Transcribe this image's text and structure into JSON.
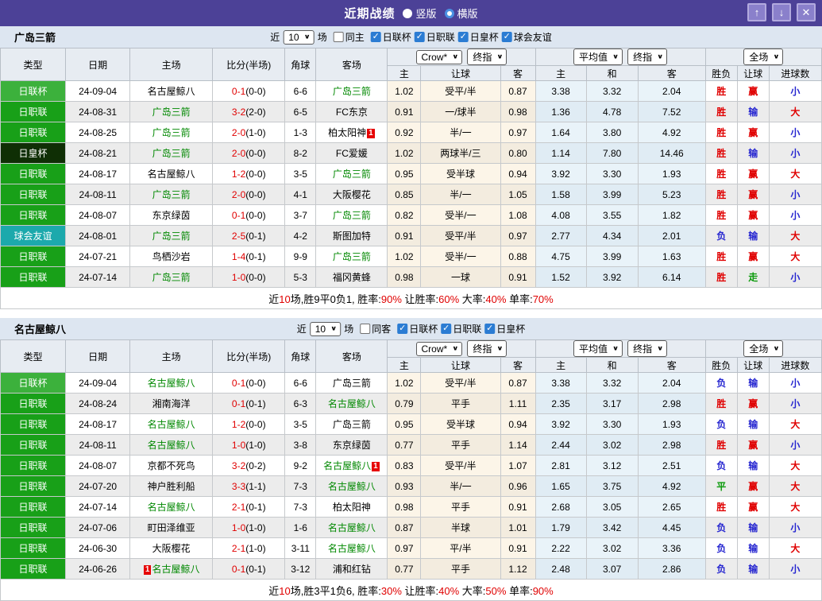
{
  "icons": {
    "check": "✓",
    "chevron": "∨",
    "up": "↑",
    "down": "↓",
    "close": "✕"
  },
  "colors": {
    "titlebar_bg": "#4c4197",
    "titlebar_button_bg": "#8a80cb",
    "section_bar_bg": "#dde6f1",
    "header_bg": "#e7ecf2",
    "league_cup": "#3cb13c",
    "league_j1": "#18a018",
    "league_emperor": "#0f2f05",
    "league_friendly": "#1ca9ac",
    "focus_team": "#008800",
    "score_red": "#e00000",
    "win_red": "#e00000",
    "lose_blue": "#2525d0",
    "draw_green": "#0a9a0a",
    "handicap_col_bg": "#fcf5e8",
    "avg_col_bg": "#e9f3f9",
    "red_card_badge": "#e60000",
    "checkbox_blue": "#2b7cd3"
  },
  "titlebar": {
    "title": "近期战绩",
    "radio_vertical": "竖版",
    "radio_horizontal": "横版"
  },
  "columns": {
    "type": "类型",
    "date": "日期",
    "home": "主场",
    "score": "比分(半场)",
    "corner": "角球",
    "away": "客场",
    "o_home": "主",
    "o_hcap": "让球",
    "o_away": "客",
    "a_home": "主",
    "a_draw": "和",
    "a_away": "客",
    "r_result": "胜负",
    "r_hcap": "让球",
    "r_goals": "进球数"
  },
  "tables": {
    "t1": {
      "team": "广岛三箭",
      "controls": {
        "near": "近",
        "count": "10",
        "games": "场",
        "same": "同主",
        "leagues": [
          "日联杯",
          "日职联",
          "日皇杯",
          "球会友谊"
        ]
      },
      "selects": {
        "odds_source": "Crow*",
        "odds_time": "终指",
        "avg": "平均值",
        "avg_time": "终指",
        "scope": "全场"
      },
      "rows": [
        {
          "lg": "日联杯",
          "lk": "cup",
          "date": "24-09-04",
          "hp": "",
          "h": "名古屋鲸八",
          "hb": "",
          "score": "0-1",
          "half": "(0-0)",
          "ck": "6-6",
          "ap": "",
          "a": "广岛三箭",
          "ab": "",
          "o1": "1.02",
          "oh": "受平/半",
          "o2": "0.87",
          "m1": "3.38",
          "m2": "3.32",
          "m3": "2.04",
          "r1": "胜",
          "r2": "赢",
          "r3": "小"
        },
        {
          "lg": "日职联",
          "lk": "j",
          "date": "24-08-31",
          "hp": "",
          "h": "广岛三箭",
          "hb": "",
          "score": "3-2",
          "half": "(2-0)",
          "ck": "6-5",
          "ap": "",
          "a": "FC东京",
          "ab": "",
          "o1": "0.91",
          "oh": "一/球半",
          "o2": "0.98",
          "m1": "1.36",
          "m2": "4.78",
          "m3": "7.52",
          "r1": "胜",
          "r2": "输",
          "r3": "大"
        },
        {
          "lg": "日职联",
          "lk": "j",
          "date": "24-08-25",
          "hp": "",
          "h": "广岛三箭",
          "hb": "",
          "score": "2-0",
          "half": "(1-0)",
          "ck": "1-3",
          "ap": "",
          "a": "柏太阳神",
          "ab": "1",
          "o1": "0.92",
          "oh": "半/一",
          "o2": "0.97",
          "m1": "1.64",
          "m2": "3.80",
          "m3": "4.92",
          "r1": "胜",
          "r2": "赢",
          "r3": "小"
        },
        {
          "lg": "日皇杯",
          "lk": "emp",
          "date": "24-08-21",
          "hp": "",
          "h": "广岛三箭",
          "hb": "",
          "score": "2-0",
          "half": "(0-0)",
          "ck": "8-2",
          "ap": "",
          "a": "FC爱媛",
          "ab": "",
          "o1": "1.02",
          "oh": "两球半/三",
          "o2": "0.80",
          "m1": "1.14",
          "m2": "7.80",
          "m3": "14.46",
          "r1": "胜",
          "r2": "输",
          "r3": "小"
        },
        {
          "lg": "日职联",
          "lk": "j",
          "date": "24-08-17",
          "hp": "",
          "h": "名古屋鲸八",
          "hb": "",
          "score": "1-2",
          "half": "(0-0)",
          "ck": "3-5",
          "ap": "",
          "a": "广岛三箭",
          "ab": "",
          "o1": "0.95",
          "oh": "受半球",
          "o2": "0.94",
          "m1": "3.92",
          "m2": "3.30",
          "m3": "1.93",
          "r1": "胜",
          "r2": "赢",
          "r3": "大"
        },
        {
          "lg": "日职联",
          "lk": "j",
          "date": "24-08-11",
          "hp": "",
          "h": "广岛三箭",
          "hb": "",
          "score": "2-0",
          "half": "(0-0)",
          "ck": "4-1",
          "ap": "",
          "a": "大阪樱花",
          "ab": "",
          "o1": "0.85",
          "oh": "半/一",
          "o2": "1.05",
          "m1": "1.58",
          "m2": "3.99",
          "m3": "5.23",
          "r1": "胜",
          "r2": "赢",
          "r3": "小"
        },
        {
          "lg": "日职联",
          "lk": "j",
          "date": "24-08-07",
          "hp": "",
          "h": "东京绿茵",
          "hb": "",
          "score": "0-1",
          "half": "(0-0)",
          "ck": "3-7",
          "ap": "",
          "a": "广岛三箭",
          "ab": "",
          "o1": "0.82",
          "oh": "受半/一",
          "o2": "1.08",
          "m1": "4.08",
          "m2": "3.55",
          "m3": "1.82",
          "r1": "胜",
          "r2": "赢",
          "r3": "小"
        },
        {
          "lg": "球会友谊",
          "lk": "fr",
          "date": "24-08-01",
          "hp": "",
          "h": "广岛三箭",
          "hb": "",
          "score": "2-5",
          "half": "(0-1)",
          "ck": "4-2",
          "ap": "",
          "a": "斯图加特",
          "ab": "",
          "o1": "0.91",
          "oh": "受平/半",
          "o2": "0.97",
          "m1": "2.77",
          "m2": "4.34",
          "m3": "2.01",
          "r1": "负",
          "r2": "输",
          "r3": "大"
        },
        {
          "lg": "日职联",
          "lk": "j",
          "date": "24-07-21",
          "hp": "",
          "h": "鸟栖沙岩",
          "hb": "",
          "score": "1-4",
          "half": "(0-1)",
          "ck": "9-9",
          "ap": "",
          "a": "广岛三箭",
          "ab": "",
          "o1": "1.02",
          "oh": "受半/一",
          "o2": "0.88",
          "m1": "4.75",
          "m2": "3.99",
          "m3": "1.63",
          "r1": "胜",
          "r2": "赢",
          "r3": "大"
        },
        {
          "lg": "日职联",
          "lk": "j",
          "date": "24-07-14",
          "hp": "",
          "h": "广岛三箭",
          "hb": "",
          "score": "1-0",
          "half": "(0-0)",
          "ck": "5-3",
          "ap": "",
          "a": "福冈黄蜂",
          "ab": "",
          "o1": "0.98",
          "oh": "一球",
          "o2": "0.91",
          "m1": "1.52",
          "m2": "3.92",
          "m3": "6.14",
          "r1": "胜",
          "r2": "走",
          "r3": "小"
        }
      ],
      "summary": {
        "p1": "近",
        "p2": "10",
        "p3": "场,胜9平0负1, 胜率:",
        "p4": "90%",
        "p5": " 让胜率:",
        "p6": "60%",
        "p7": " 大率:",
        "p8": "40%",
        "p9": " 单率:",
        "p10": "70%"
      }
    },
    "t2": {
      "team": "名古屋鲸八",
      "controls": {
        "near": "近",
        "count": "10",
        "games": "场",
        "same": "同客",
        "leagues": [
          "日联杯",
          "日职联",
          "日皇杯"
        ]
      },
      "selects": {
        "odds_source": "Crow*",
        "odds_time": "终指",
        "avg": "平均值",
        "avg_time": "终指",
        "scope": "全场"
      },
      "rows": [
        {
          "lg": "日联杯",
          "lk": "cup",
          "date": "24-09-04",
          "hp": "",
          "h": "名古屋鲸八",
          "hb": "",
          "score": "0-1",
          "half": "(0-0)",
          "ck": "6-6",
          "ap": "",
          "a": "广岛三箭",
          "ab": "",
          "o1": "1.02",
          "oh": "受平/半",
          "o2": "0.87",
          "m1": "3.38",
          "m2": "3.32",
          "m3": "2.04",
          "r1": "负",
          "r2": "输",
          "r3": "小"
        },
        {
          "lg": "日职联",
          "lk": "j",
          "date": "24-08-24",
          "hp": "",
          "h": "湘南海洋",
          "hb": "",
          "score": "0-1",
          "half": "(0-1)",
          "ck": "6-3",
          "ap": "",
          "a": "名古屋鲸八",
          "ab": "",
          "o1": "0.79",
          "oh": "平手",
          "o2": "1.11",
          "m1": "2.35",
          "m2": "3.17",
          "m3": "2.98",
          "r1": "胜",
          "r2": "赢",
          "r3": "小"
        },
        {
          "lg": "日职联",
          "lk": "j",
          "date": "24-08-17",
          "hp": "",
          "h": "名古屋鲸八",
          "hb": "",
          "score": "1-2",
          "half": "(0-0)",
          "ck": "3-5",
          "ap": "",
          "a": "广岛三箭",
          "ab": "",
          "o1": "0.95",
          "oh": "受半球",
          "o2": "0.94",
          "m1": "3.92",
          "m2": "3.30",
          "m3": "1.93",
          "r1": "负",
          "r2": "输",
          "r3": "大"
        },
        {
          "lg": "日职联",
          "lk": "j",
          "date": "24-08-11",
          "hp": "",
          "h": "名古屋鲸八",
          "hb": "",
          "score": "1-0",
          "half": "(1-0)",
          "ck": "3-8",
          "ap": "",
          "a": "东京绿茵",
          "ab": "",
          "o1": "0.77",
          "oh": "平手",
          "o2": "1.14",
          "m1": "2.44",
          "m2": "3.02",
          "m3": "2.98",
          "r1": "胜",
          "r2": "赢",
          "r3": "小"
        },
        {
          "lg": "日职联",
          "lk": "j",
          "date": "24-08-07",
          "hp": "",
          "h": "京都不死鸟",
          "hb": "",
          "score": "3-2",
          "half": "(0-2)",
          "ck": "9-2",
          "ap": "",
          "a": "名古屋鲸八",
          "ab": "1",
          "o1": "0.83",
          "oh": "受平/半",
          "o2": "1.07",
          "m1": "2.81",
          "m2": "3.12",
          "m3": "2.51",
          "r1": "负",
          "r2": "输",
          "r3": "大"
        },
        {
          "lg": "日职联",
          "lk": "j",
          "date": "24-07-20",
          "hp": "",
          "h": "神户胜利船",
          "hb": "",
          "score": "3-3",
          "half": "(1-1)",
          "ck": "7-3",
          "ap": "",
          "a": "名古屋鲸八",
          "ab": "",
          "o1": "0.93",
          "oh": "半/一",
          "o2": "0.96",
          "m1": "1.65",
          "m2": "3.75",
          "m3": "4.92",
          "r1": "平",
          "r2": "赢",
          "r3": "大"
        },
        {
          "lg": "日职联",
          "lk": "j",
          "date": "24-07-14",
          "hp": "",
          "h": "名古屋鲸八",
          "hb": "",
          "score": "2-1",
          "half": "(0-1)",
          "ck": "7-3",
          "ap": "",
          "a": "柏太阳神",
          "ab": "",
          "o1": "0.98",
          "oh": "平手",
          "o2": "0.91",
          "m1": "2.68",
          "m2": "3.05",
          "m3": "2.65",
          "r1": "胜",
          "r2": "赢",
          "r3": "大"
        },
        {
          "lg": "日职联",
          "lk": "j",
          "date": "24-07-06",
          "hp": "",
          "h": "町田泽维亚",
          "hb": "",
          "score": "1-0",
          "half": "(1-0)",
          "ck": "1-6",
          "ap": "",
          "a": "名古屋鲸八",
          "ab": "",
          "o1": "0.87",
          "oh": "半球",
          "o2": "1.01",
          "m1": "1.79",
          "m2": "3.42",
          "m3": "4.45",
          "r1": "负",
          "r2": "输",
          "r3": "小"
        },
        {
          "lg": "日职联",
          "lk": "j",
          "date": "24-06-30",
          "hp": "",
          "h": "大阪樱花",
          "hb": "",
          "score": "2-1",
          "half": "(1-0)",
          "ck": "3-11",
          "ap": "",
          "a": "名古屋鲸八",
          "ab": "",
          "o1": "0.97",
          "oh": "平/半",
          "o2": "0.91",
          "m1": "2.22",
          "m2": "3.02",
          "m3": "3.36",
          "r1": "负",
          "r2": "输",
          "r3": "大"
        },
        {
          "lg": "日职联",
          "lk": "j",
          "date": "24-06-26",
          "hp": "1",
          "h": "名古屋鲸八",
          "hb": "",
          "score": "0-1",
          "half": "(0-1)",
          "ck": "3-12",
          "ap": "",
          "a": "浦和红钻",
          "ab": "",
          "o1": "0.77",
          "oh": "平手",
          "o2": "1.12",
          "m1": "2.48",
          "m2": "3.07",
          "m3": "2.86",
          "r1": "负",
          "r2": "输",
          "r3": "小"
        }
      ],
      "summary": {
        "p1": "近",
        "p2": "10",
        "p3": "场,胜3平1负6, 胜率:",
        "p4": "30%",
        "p5": " 让胜率:",
        "p6": "40%",
        "p7": " 大率:",
        "p8": "50%",
        "p9": " 单率:",
        "p10": "90%"
      }
    }
  }
}
